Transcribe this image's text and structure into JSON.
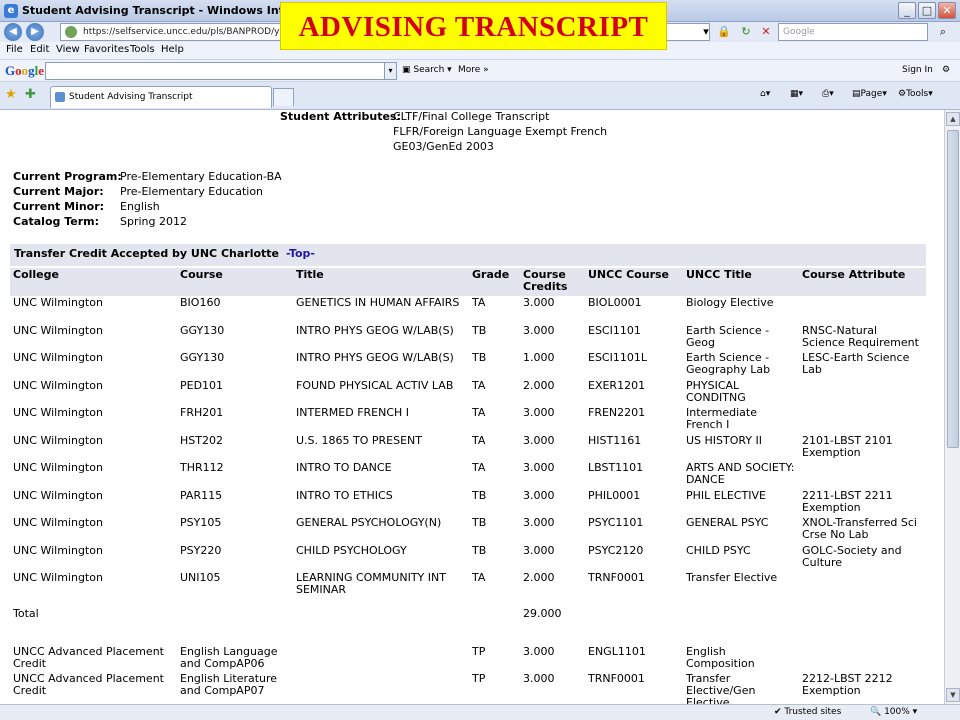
{
  "window": {
    "title": "Student Advising Transcript - Windows Internet Explorer",
    "controls": [
      "_",
      "□",
      "✕"
    ]
  },
  "banner": {
    "text": "ADVISING TRANSCRIPT"
  },
  "address": {
    "url": "https://selfservice.uncc.edu/pls/BANPROD/ywcktran.P_",
    "search_placeholder": "Google"
  },
  "menu": {
    "items": [
      "File",
      "Edit",
      "View",
      "Favorites",
      "Tools",
      "Help"
    ]
  },
  "google_toolbar": {
    "logo": "Google",
    "search_label": "Search",
    "more_label": "More »",
    "signin_label": "Sign In"
  },
  "tabs": {
    "active_label": "Student Advising Transcript",
    "commands": [
      "Page",
      "Tools"
    ]
  },
  "attributes": {
    "label": "Student Attributes:",
    "values": [
      "CLTF/Final College Transcript",
      "FLFR/Foreign Language Exempt French",
      "GE03/GenEd 2003"
    ]
  },
  "program": {
    "rows": [
      {
        "label": "Current Program:",
        "value": "Pre-Elementary Education-BA"
      },
      {
        "label": "Current Major:",
        "value": "Pre-Elementary Education"
      },
      {
        "label": "Current Minor:",
        "value": "English"
      },
      {
        "label": "Catalog Term:",
        "value": "Spring 2012"
      }
    ]
  },
  "transfer": {
    "section_title": "Transfer Credit Accepted by UNC Charlotte",
    "top_link": "-Top-",
    "headers": [
      "College",
      "Course",
      "Title",
      "Grade",
      "Course Credits",
      "UNCC Course",
      "UNCC Title",
      "Course Attribute"
    ],
    "rows": [
      [
        "UNC Wilmington",
        "BIO160",
        "GENETICS IN HUMAN AFFAIRS",
        "TA",
        "3.000",
        "BIOL0001",
        "Biology Elective",
        ""
      ],
      [
        "UNC Wilmington",
        "GGY130",
        "INTRO PHYS GEOG W/LAB(S)",
        "TB",
        "3.000",
        "ESCI1101",
        "Earth Science - Geog",
        "RNSC-Natural Science Requirement"
      ],
      [
        "UNC Wilmington",
        "GGY130",
        "INTRO PHYS GEOG W/LAB(S)",
        "TB",
        "1.000",
        "ESCI1101L",
        "Earth Science - Geography Lab",
        "LESC-Earth Science Lab"
      ],
      [
        "UNC Wilmington",
        "PED101",
        "FOUND PHYSICAL ACTIV LAB",
        "TA",
        "2.000",
        "EXER1201",
        "PHYSICAL CONDITNG",
        ""
      ],
      [
        "UNC Wilmington",
        "FRH201",
        "INTERMED FRENCH I",
        "TA",
        "3.000",
        "FREN2201",
        "Intermediate French I",
        ""
      ],
      [
        "UNC Wilmington",
        "HST202",
        "U.S. 1865 TO PRESENT",
        "TA",
        "3.000",
        "HIST1161",
        "US HISTORY II",
        "2101-LBST 2101 Exemption"
      ],
      [
        "UNC Wilmington",
        "THR112",
        "INTRO TO DANCE",
        "TA",
        "3.000",
        "LBST1101",
        "ARTS AND SOCIETY: DANCE",
        ""
      ],
      [
        "UNC Wilmington",
        "PAR115",
        "INTRO TO ETHICS",
        "TB",
        "3.000",
        "PHIL0001",
        "PHIL ELECTIVE",
        "2211-LBST 2211 Exemption"
      ],
      [
        "UNC Wilmington",
        "PSY105",
        "GENERAL PSYCHOLOGY(N)",
        "TB",
        "3.000",
        "PSYC1101",
        "GENERAL PSYC",
        "XNOL-Transferred Sci Crse No Lab"
      ],
      [
        "UNC Wilmington",
        "PSY220",
        "CHILD PSYCHOLOGY",
        "TB",
        "3.000",
        "PSYC2120",
        "CHILD PSYC",
        "GOLC-Society and Culture"
      ],
      [
        "UNC Wilmington",
        "UNI105",
        "LEARNING COMMUNITY INT SEMINAR",
        "TA",
        "2.000",
        "TRNF0001",
        "Transfer Elective",
        ""
      ]
    ],
    "total_label": "Total",
    "total_credits": "29.000",
    "ap_rows": [
      [
        "UNCC Advanced Placement Credit",
        "English Language and CompAP06",
        "",
        "TP",
        "3.000",
        "ENGL1101",
        "English Composition",
        ""
      ],
      [
        "UNCC Advanced Placement Credit",
        "English Literature and CompAP07",
        "",
        "TP",
        "3.000",
        "TRNF0001",
        "Transfer Elective/Gen Elective",
        "2212-LBST 2212 Exemption"
      ]
    ]
  },
  "status": {
    "zone": "Trusted sites",
    "zoom": "100%"
  },
  "colors": {
    "header_bg": "#e2e4ee",
    "banner_bg": "#ffff00",
    "banner_text": "#d4001a",
    "link": "#1a1aa6"
  }
}
